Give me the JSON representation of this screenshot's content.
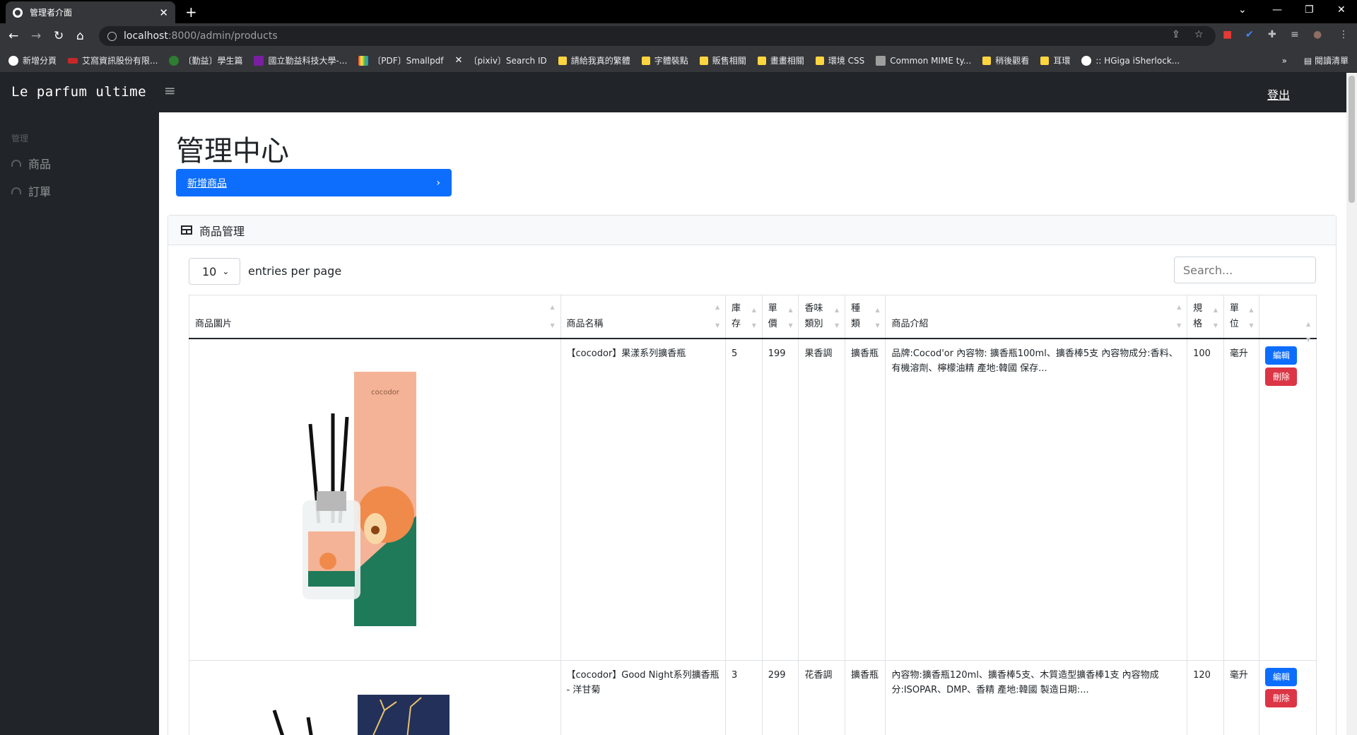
{
  "browser": {
    "tab_title": "管理者介面",
    "url_host": "localhost",
    "url_path": ":8000/admin/products",
    "bookmarks": [
      "新增分頁",
      "艾窩資訊股份有限...",
      "〔勤益〕學生篇",
      "國立勤益科技大學-...",
      "〔PDF〕Smallpdf",
      "〔pixiv〕Search ID",
      "請給我真的繁體",
      "字體裝點",
      "販售相關",
      "畫畫相關",
      "環境 CSS",
      "Common MIME ty...",
      "稍後觀看",
      "耳環",
      ":: HGiga iSherlock..."
    ],
    "reading_list": "閱讀清單"
  },
  "app": {
    "brand": "Le parfum ultime",
    "logout": "登出",
    "sidebar": {
      "heading": "管理",
      "items": [
        {
          "label": "商品"
        },
        {
          "label": "訂單"
        }
      ]
    },
    "page_title": "管理中心",
    "add_button": "新增商品",
    "card_title": "商品管理",
    "per_page_value": "10",
    "per_page_label": "entries per page",
    "search_placeholder": "Search..."
  },
  "table": {
    "headers": [
      "商品圖片",
      "商品名稱",
      "庫存",
      "單價",
      "香味類別",
      "種類",
      "商品介紹",
      "規格",
      "單位",
      ""
    ],
    "rows": [
      {
        "name": "【cocodor】果漾系列擴香瓶",
        "stock": "5",
        "price": "199",
        "scent": "果香調",
        "kind": "擴香瓶",
        "desc": "品牌:Cocod'or 內容物: 擴香瓶100ml、擴香棒5支 內容物成分:香料、有機溶劑、檸檬油精 產地:韓國 保存...",
        "spec": "100",
        "unit": "毫升",
        "edit": "編輯",
        "delete": "刪除"
      },
      {
        "name": "【cocodor】Good Night系列擴香瓶 - 洋甘菊",
        "stock": "3",
        "price": "299",
        "scent": "花香調",
        "kind": "擴香瓶",
        "desc": "內容物:擴香瓶120ml、擴香棒5支、木質造型擴香棒1支 內容物成分:ISOPAR、DMP、香精 產地:韓國 製造日期:...",
        "spec": "120",
        "unit": "毫升",
        "edit": "編輯",
        "delete": "刪除"
      }
    ]
  }
}
